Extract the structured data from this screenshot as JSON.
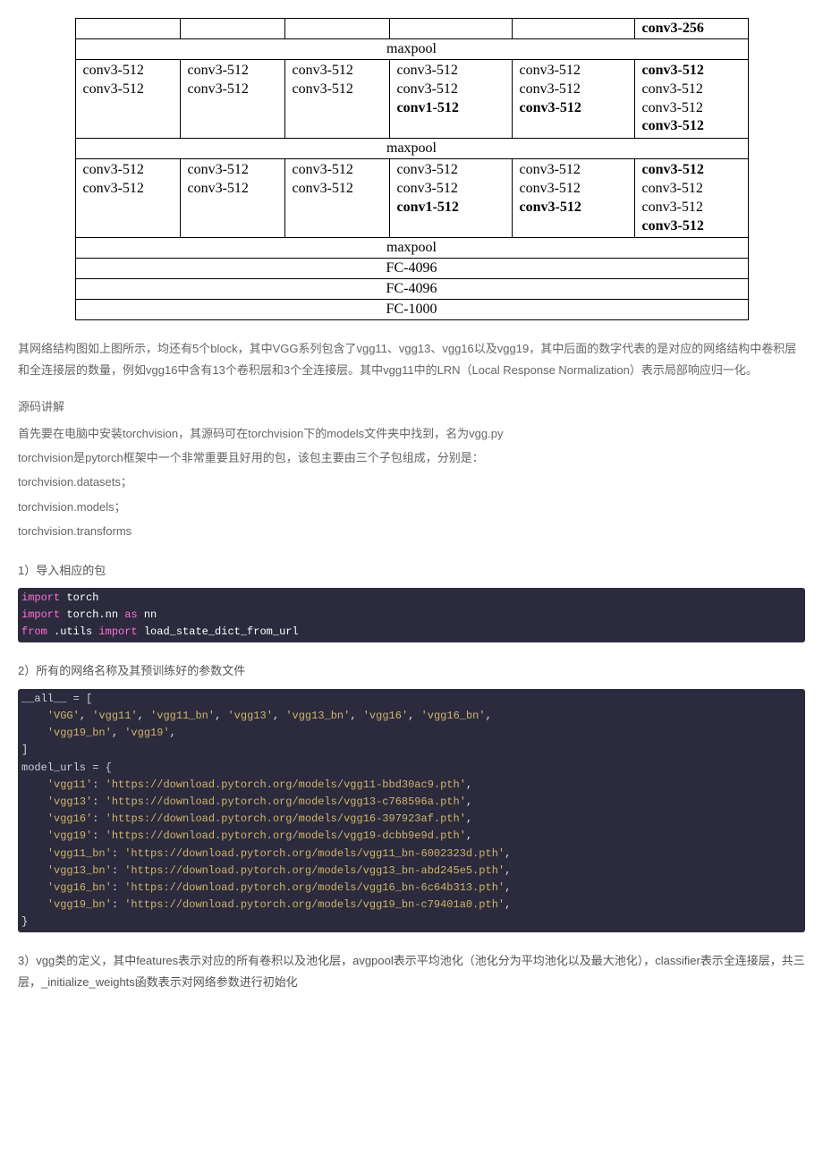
{
  "table": {
    "row0_last": "conv3-256",
    "maxpool": "maxpool",
    "fc4096": "FC-4096",
    "fc1000": "FC-1000",
    "block_a": {
      "cols": [
        [
          "conv3-512",
          "conv3-512"
        ],
        [
          "conv3-512",
          "conv3-512"
        ],
        [
          "conv3-512",
          "conv3-512"
        ],
        [
          "conv3-512",
          "conv3-512",
          "conv1-512"
        ],
        [
          "conv3-512",
          "conv3-512",
          "conv3-512"
        ],
        [
          "conv3-512",
          "conv3-512",
          "conv3-512",
          "conv3-512"
        ]
      ]
    },
    "block_b": {
      "cols": [
        [
          "conv3-512",
          "conv3-512"
        ],
        [
          "conv3-512",
          "conv3-512"
        ],
        [
          "conv3-512",
          "conv3-512"
        ],
        [
          "conv3-512",
          "conv3-512",
          "conv1-512"
        ],
        [
          "conv3-512",
          "conv3-512",
          "conv3-512"
        ],
        [
          "conv3-512",
          "conv3-512",
          "conv3-512",
          "conv3-512"
        ]
      ]
    }
  },
  "para1": "其网络结构图如上图所示，均还有5个block，其中VGG系列包含了vgg11、vgg13、vgg16以及vgg19，其中后面的数字代表的是对应的网络结构中卷积层和全连接层的数量，例如vgg16中含有13个卷积层和3个全连接层。其中vgg11中的LRN（Local Response Normalization）表示局部响应归一化。",
  "sec_heading": "源码讲解",
  "para2": "首先要在电脑中安装torchvision，其源码可在torchvision下的models文件夹中找到，名为vgg.py",
  "para3": "torchvision是pytorch框架中一个非常重要且好用的包，该包主要由三个子包组成，分别是：",
  "para4": "torchvision.datasets；",
  "para5": "torchvision.models；",
  "para6": "torchvision.transforms",
  "h1": "1）导入相应的包",
  "code1": {
    "l1_import": "import",
    "l1_mod": " torch",
    "l2_import": "import",
    "l2_mod": " torch.nn ",
    "l2_as": "as",
    "l2_alias": " nn",
    "l3_from": "from",
    "l3_mod": " .utils ",
    "l3_import": "import",
    "l3_name": " load_state_dict_from_url"
  },
  "h2": "2）所有的网络名称及其预训练好的参数文件",
  "code2": {
    "l1": "__all__ = [",
    "l2a": "    ",
    "l2s1": "'VGG'",
    "l2c": ", ",
    "l2s2": "'vgg11'",
    "l2s3": "'vgg11_bn'",
    "l2s4": "'vgg13'",
    "l2s5": "'vgg13_bn'",
    "l2s6": "'vgg16'",
    "l2s7": "'vgg16_bn'",
    "l3a": "    ",
    "l3s1": "'vgg19_bn'",
    "l3s2": "'vgg19'",
    "l4": "]",
    "l_blank": "",
    "l6": "model_urls = {",
    "urls": [
      {
        "k": "'vgg11'",
        "v": "'https://download.pytorch.org/models/vgg11-bbd30ac9.pth'"
      },
      {
        "k": "'vgg13'",
        "v": "'https://download.pytorch.org/models/vgg13-c768596a.pth'"
      },
      {
        "k": "'vgg16'",
        "v": "'https://download.pytorch.org/models/vgg16-397923af.pth'"
      },
      {
        "k": "'vgg19'",
        "v": "'https://download.pytorch.org/models/vgg19-dcbb9e9d.pth'"
      },
      {
        "k": "'vgg11_bn'",
        "v": "'https://download.pytorch.org/models/vgg11_bn-6002323d.pth'"
      },
      {
        "k": "'vgg13_bn'",
        "v": "'https://download.pytorch.org/models/vgg13_bn-abd245e5.pth'"
      },
      {
        "k": "'vgg16_bn'",
        "v": "'https://download.pytorch.org/models/vgg16_bn-6c64b313.pth'"
      },
      {
        "k": "'vgg19_bn'",
        "v": "'https://download.pytorch.org/models/vgg19_bn-c79401a0.pth'"
      }
    ],
    "l_end": "}"
  },
  "h3": "3）vgg类的定义，其中features表示对应的所有卷积以及池化层，avgpool表示平均池化（池化分为平均池化以及最大池化），classifier表示全连接层，共三层，_initialize_weights函数表示对网络参数进行初始化"
}
